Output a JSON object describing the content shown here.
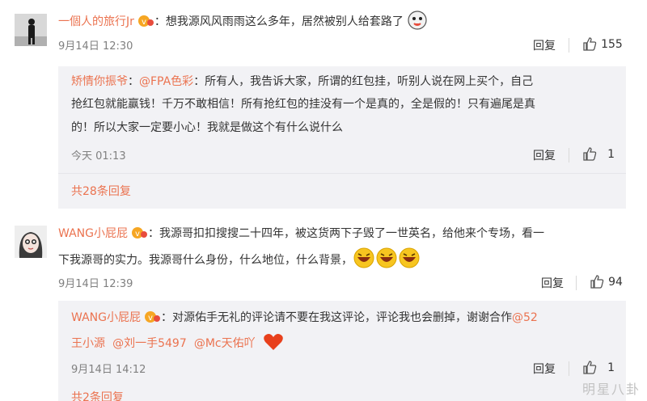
{
  "comments": [
    {
      "username": "一個人的旅行Jr",
      "text": "：想我源风风雨雨这么多年，居然被别人给套路了",
      "time": "9月14日 12:30",
      "reply_label": "回复",
      "likes": "155",
      "avatar_icon": "silhouette-man-icon",
      "reply": {
        "username": "矫情你振爷",
        "colon": "：",
        "mention": "@FPA色彩",
        "line1": "：所有人，我告诉大家，所谓的红包挂，听别人说在网上买个，自己",
        "line2": "抢红包就能赢钱！千万不敢相信！所有抢红包的挂没有一个是真的，全是假的！只有遍尾是真",
        "line3": "的！所以大家一定要小心！我就是做这个有什么说什么",
        "time": "今天 01:13",
        "reply_label": "回复",
        "likes": "1"
      },
      "all_replies": "共28条回复"
    },
    {
      "username": "WANG小屁屁",
      "line1": "：我源哥扣扣搜搜二十四年，被这货两下子毁了一世英名，给他来个专场，看一",
      "line2": "下我源哥的实力。我源哥什么身份，什么地位，什么背景，",
      "time": "9月14日 12:39",
      "reply_label": "回复",
      "likes": "94",
      "avatar_icon": "girl-avatar-icon",
      "reply": {
        "username": "WANG小屁屁",
        "line1": "：对源佑手无礼的评论请不要在我这评论，评论我也会删掉，谢谢合作",
        "mention1": "@52",
        "mention1b": "王小源",
        "mention2": "@刘一手5497",
        "mention3": "@Mc天佑吖",
        "time": "9月14日 14:12",
        "reply_label": "回复",
        "likes": "1"
      },
      "all_replies": "共2条回复"
    }
  ],
  "watermark": "明星八卦",
  "colors": {
    "accent": "#eb7350",
    "reply_bg": "#f2f2f5",
    "text": "#333333",
    "meta": "#808080"
  }
}
